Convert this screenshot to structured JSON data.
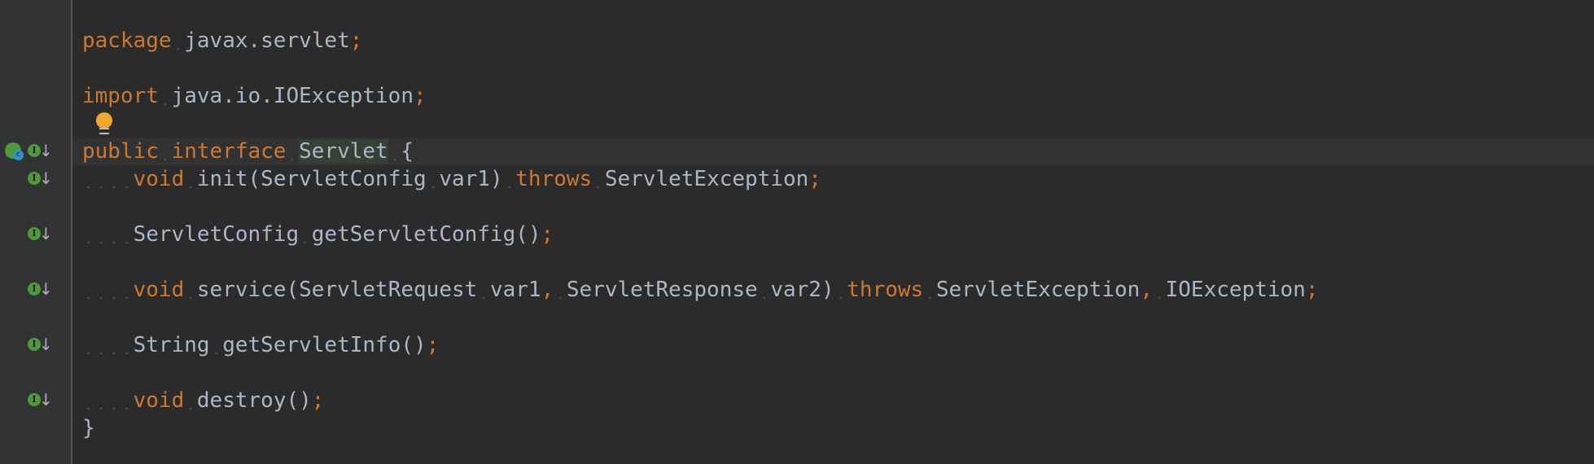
{
  "colors": {
    "keyword": "#cc7832",
    "identifier": "#a9b7c6",
    "background": "#2b2b2b",
    "gutter": "#313335"
  },
  "gutter_icons": [
    {
      "line": 5,
      "icons": [
        "class-implemented-icon",
        "implemented-down-icon"
      ]
    },
    {
      "line": 6,
      "icons": [
        "implemented-down-icon"
      ]
    },
    {
      "line": 8,
      "icons": [
        "implemented-down-icon"
      ]
    },
    {
      "line": 10,
      "icons": [
        "implemented-down-icon"
      ]
    },
    {
      "line": 12,
      "icons": [
        "implemented-down-icon"
      ]
    },
    {
      "line": 14,
      "icons": [
        "implemented-down-icon"
      ]
    }
  ],
  "gutter_labels": {
    "implemented": "I",
    "arrow": "↓",
    "class_badge": "c"
  },
  "lines": [
    [
      [
        "package",
        "kw"
      ],
      [
        " ",
        "ws"
      ],
      [
        "javax.servlet",
        "id"
      ],
      [
        ";",
        "semi"
      ]
    ],
    [],
    [
      [
        "import",
        "kw"
      ],
      [
        " ",
        "ws"
      ],
      [
        "java.io.IOException",
        "id"
      ],
      [
        ";",
        "semi"
      ]
    ],
    [],
    [
      [
        "public",
        "kw"
      ],
      [
        " ",
        "ws"
      ],
      [
        "interface",
        "kw"
      ],
      [
        " ",
        "ws"
      ],
      [
        "Servlet",
        "hl"
      ],
      [
        " ",
        "ws"
      ],
      [
        "{",
        "punc"
      ]
    ],
    [
      [
        "    ",
        "ws"
      ],
      [
        "void",
        "kw"
      ],
      [
        " ",
        "ws"
      ],
      [
        "init(ServletConfig",
        "id"
      ],
      [
        " ",
        "ws"
      ],
      [
        "var1)",
        "id"
      ],
      [
        " ",
        "ws"
      ],
      [
        "throws",
        "kw"
      ],
      [
        " ",
        "ws"
      ],
      [
        "ServletException",
        "id"
      ],
      [
        ";",
        "semi"
      ]
    ],
    [],
    [
      [
        "    ",
        "ws"
      ],
      [
        "ServletConfig",
        "id"
      ],
      [
        " ",
        "ws"
      ],
      [
        "getServletConfig()",
        "id"
      ],
      [
        ";",
        "semi"
      ]
    ],
    [],
    [
      [
        "    ",
        "ws"
      ],
      [
        "void",
        "kw"
      ],
      [
        " ",
        "ws"
      ],
      [
        "service(ServletRequest",
        "id"
      ],
      [
        " ",
        "ws"
      ],
      [
        "var1",
        "id"
      ],
      [
        ",",
        "semi"
      ],
      [
        " ",
        "ws"
      ],
      [
        "ServletResponse",
        "id"
      ],
      [
        " ",
        "ws"
      ],
      [
        "var2)",
        "id"
      ],
      [
        " ",
        "ws"
      ],
      [
        "throws",
        "kw"
      ],
      [
        " ",
        "ws"
      ],
      [
        "ServletException",
        "id"
      ],
      [
        ",",
        "semi"
      ],
      [
        " ",
        "ws"
      ],
      [
        "IOException",
        "id"
      ],
      [
        ";",
        "semi"
      ]
    ],
    [],
    [
      [
        "    ",
        "ws"
      ],
      [
        "String",
        "id"
      ],
      [
        " ",
        "ws"
      ],
      [
        "getServletInfo()",
        "id"
      ],
      [
        ";",
        "semi"
      ]
    ],
    [],
    [
      [
        "    ",
        "ws"
      ],
      [
        "void",
        "kw"
      ],
      [
        " ",
        "ws"
      ],
      [
        "destroy()",
        "id"
      ],
      [
        ";",
        "semi"
      ]
    ],
    [
      [
        "}",
        "punc"
      ]
    ]
  ]
}
